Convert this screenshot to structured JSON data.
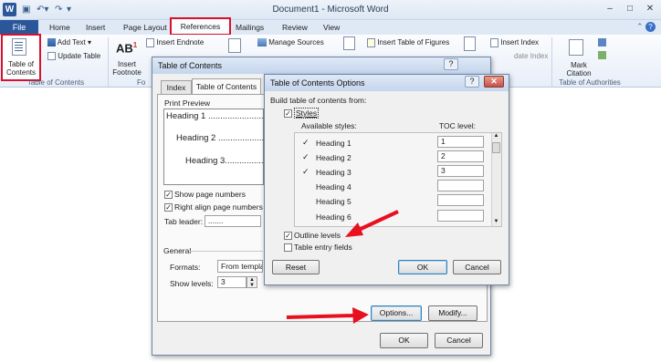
{
  "window": {
    "app_logo": "W",
    "title": "Document1 - Microsoft Word",
    "qat_icons": [
      "save-icon",
      "undo-icon",
      "redo-icon"
    ],
    "controls": [
      "minimize",
      "maximize",
      "close"
    ],
    "minimize_glyph": "–",
    "maximize_glyph": "□",
    "close_glyph": "✕"
  },
  "ribbon": {
    "tabs": [
      "File",
      "Home",
      "Insert",
      "Page Layout",
      "References",
      "Mailings",
      "Review",
      "View"
    ],
    "active_tab": "References",
    "help_glyph": "?",
    "toc_group": {
      "toc_button": "Table of Contents",
      "add_text": "Add Text",
      "update_table": "Update Table",
      "label": "Table of Contents"
    },
    "footnotes_group": {
      "insert_footnote": "Insert Footnote",
      "ab_glyph": "AB",
      "superscript": "1",
      "label": "Fo"
    },
    "citations_group": {
      "insert_endnote": "Insert Endnote",
      "manage_sources": "Manage Sources"
    },
    "captions_group": {
      "insert_table_of_figures": "Insert Table of Figures"
    },
    "index_group": {
      "insert_index": "Insert Index",
      "update_index": "date Index"
    },
    "authorities_group": {
      "mark_citation": "Mark Citation",
      "label": "Table of Authorities"
    }
  },
  "toc_dialog": {
    "title": "Table of Contents",
    "help": "?",
    "tabs": [
      "Index",
      "Table of Contents"
    ],
    "active_tab": "Table of Contents",
    "print_preview_label": "Print Preview",
    "preview_lines": [
      "Heading 1 ..........................",
      "Heading 2 ........................",
      "Heading 3.......................5"
    ],
    "show_page_numbers": {
      "label": "Show page numbers",
      "checked": true
    },
    "right_align": {
      "label": "Right align page numbers",
      "checked": true
    },
    "tab_leader_label": "Tab leader:",
    "tab_leader_value": ".......",
    "general_label": "General",
    "formats_label": "Formats:",
    "formats_value": "From template",
    "show_levels_label": "Show levels:",
    "show_levels_value": "3",
    "options_button": "Options...",
    "modify_button": "Modify...",
    "ok_button": "OK",
    "cancel_button": "Cancel"
  },
  "toc_options_dialog": {
    "title": "Table of Contents Options",
    "help": "?",
    "close_glyph": "✕",
    "build_label": "Build table of contents from:",
    "styles": {
      "label": "Styles",
      "checked": true
    },
    "available_styles_label": "Available styles:",
    "toc_level_label": "TOC level:",
    "rows": [
      {
        "checked": true,
        "style": "Heading 1",
        "level": "1"
      },
      {
        "checked": true,
        "style": "Heading 2",
        "level": "2"
      },
      {
        "checked": true,
        "style": "Heading 3",
        "level": "3"
      },
      {
        "checked": false,
        "style": "Heading 4",
        "level": ""
      },
      {
        "checked": false,
        "style": "Heading 5",
        "level": ""
      },
      {
        "checked": false,
        "style": "Heading 6",
        "level": ""
      }
    ],
    "outline_levels": {
      "label": "Outline levels",
      "checked": true
    },
    "table_entry_fields": {
      "label": "Table entry fields",
      "checked": false
    },
    "reset_button": "Reset",
    "ok_button": "OK",
    "cancel_button": "Cancel"
  },
  "annotation_colors": {
    "highlight": "#d9102b",
    "arrow": "#e8101f"
  }
}
